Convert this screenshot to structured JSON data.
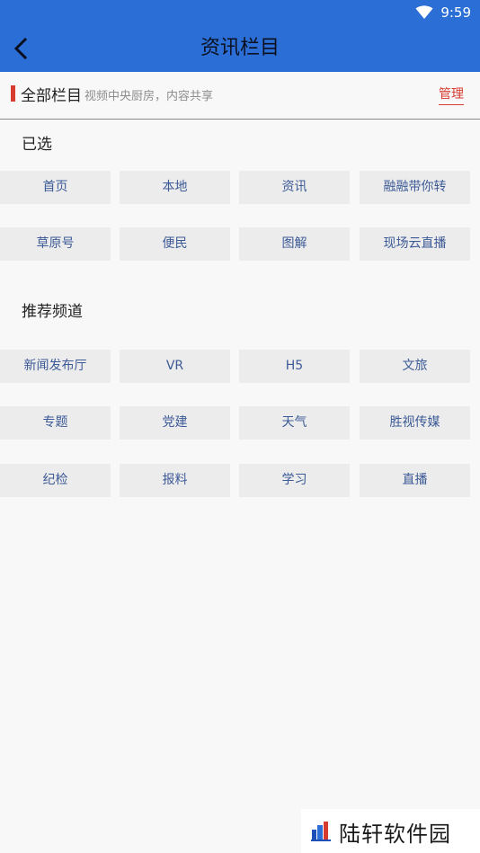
{
  "status_bar": {
    "time": "9:59",
    "wifi_icon": "wifi-icon"
  },
  "header": {
    "back_icon": "chevron-left-icon",
    "title": "资讯栏目"
  },
  "section": {
    "title": "全部栏目",
    "subtitle": "视频中央厨房，内容共享",
    "manage_label": "管理"
  },
  "selected": {
    "label": "已选",
    "items": [
      "首页",
      "本地",
      "资讯",
      "融融带你转",
      "草原号",
      "便民",
      "图解",
      "现场云直播"
    ]
  },
  "recommended": {
    "label": "推荐频道",
    "items": [
      "新闻发布厅",
      "VR",
      "H5",
      "文旅",
      "专题",
      "党建",
      "天气",
      "胜视传媒",
      "纪检",
      "报料",
      "学习",
      "直播"
    ]
  },
  "watermark": {
    "text": "陆轩软件园"
  },
  "colors": {
    "primary": "#2b6fd6",
    "accent_red": "#d73a2f",
    "chip_bg": "#ececec",
    "chip_text": "#3c5a96"
  }
}
